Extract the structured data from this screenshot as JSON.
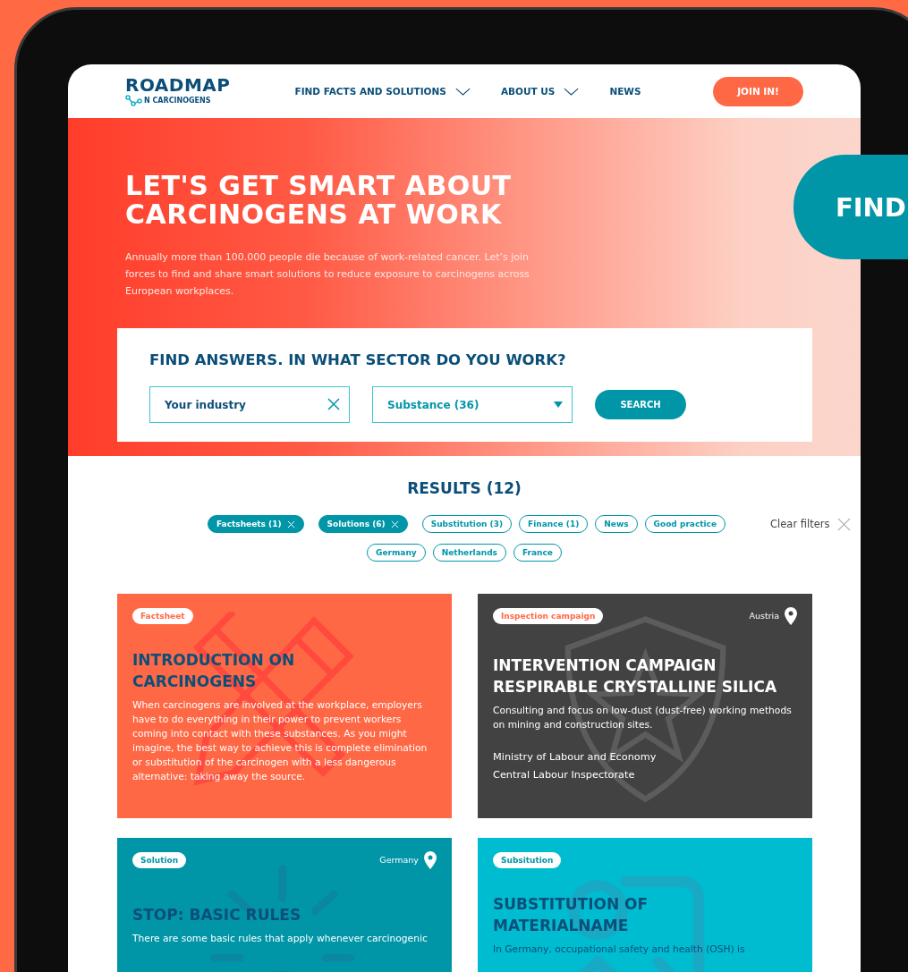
{
  "logo": {
    "title": "ROADMAP",
    "subtitle": "N CARCINOGENS"
  },
  "nav": [
    {
      "label": "FIND FACTS AND SOLUTIONS",
      "dropdown": true
    },
    {
      "label": "ABOUT US",
      "dropdown": true
    },
    {
      "label": "NEWS",
      "dropdown": false
    }
  ],
  "join_button": "JOIN IN!",
  "hero": {
    "title_lines": [
      "LET'S GET SMART ABOUT",
      "CARCINOGENS AT WORK"
    ],
    "text": "Annually more than 100.000 people die because of work-related cancer. Let’s join forces to find and share smart solutions to reduce exposure to carcinogens across European workplaces."
  },
  "side_badge": "FIND",
  "search": {
    "heading": "FIND ANSWERS. IN WHAT SECTOR DO YOU WORK?",
    "industry_field": {
      "value": "Your industry"
    },
    "substance_dropdown": {
      "value": "Substance (36)"
    },
    "button": "SEARCH"
  },
  "results": {
    "title": "RESULTS (12)",
    "clear_filters": "Clear filters",
    "filter_rows": [
      [
        {
          "label": "Factsheets (1)",
          "selected": true
        },
        {
          "label": "Solutions (6)",
          "selected": true
        },
        {
          "label": "Substitution (3)",
          "selected": false
        },
        {
          "label": "Finance (1)",
          "selected": false
        },
        {
          "label": "News",
          "selected": false
        },
        {
          "label": "Good practice",
          "selected": false
        }
      ],
      [
        {
          "label": "Germany",
          "selected": false
        },
        {
          "label": "Netherlands",
          "selected": false
        },
        {
          "label": "France",
          "selected": false
        }
      ]
    ]
  },
  "cards": [
    {
      "kind": "factsheet",
      "tag": "Factsheet",
      "title_lines": [
        "INTRODUCTION ON",
        "CARCINOGENS"
      ],
      "description": "When carcinogens are involved at the workplace, employers have to do everything in their power to prevent workers coming into contact with these substances. As you might imagine, the best way to achieve this is complete elimination or substitution of the carcinogen with a less dangerous alternative: taking away the source."
    },
    {
      "kind": "inspection",
      "tag": "Inspection campaign",
      "location": "Austria",
      "title_lines": [
        "INTERVENTION CAMPAIGN",
        "RESPIRABLE CRYSTALLINE SILICA"
      ],
      "description": "Consulting and focus on low-dust (dust-free) working methods on mining and construction sites.",
      "organisations": [
        "Ministry of Labour and Economy",
        "Central Labour Inspectorate"
      ]
    },
    {
      "kind": "solution",
      "tag": "Solution",
      "location": "Germany",
      "title_lines": [
        "STOP: BASIC RULES"
      ],
      "description": "There are some basic rules that apply whenever carcinogenic"
    },
    {
      "kind": "substitution",
      "tag": "Subsitution",
      "title_lines": [
        "SUBSTITUTION OF",
        "MATERIALNAME"
      ],
      "description": "In Germany, occupational safety and health (OSH) is"
    }
  ]
}
